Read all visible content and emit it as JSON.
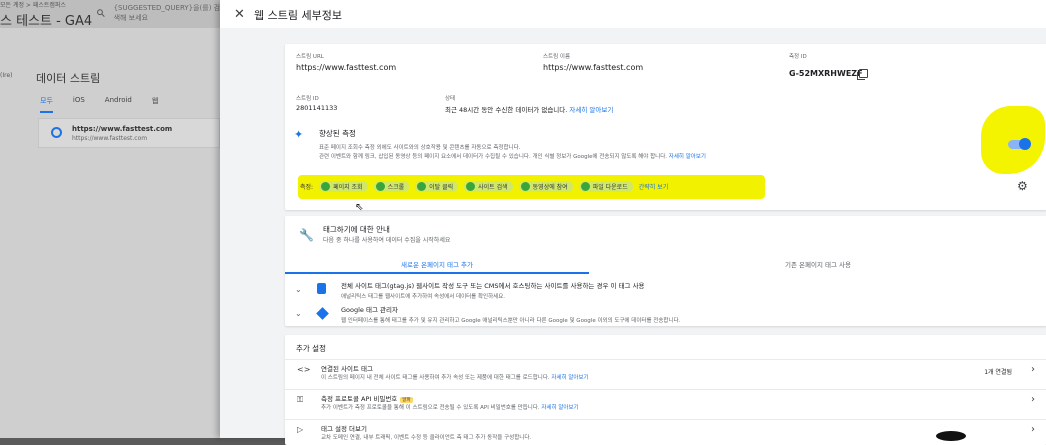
{
  "background": {
    "breadcrumb": "모든 계정 > 패스트캠퍼스",
    "property_title": "스 테스트 - GA4",
    "search_placeholder": "{SUGGESTED_QUERY}을(를) 검색해 보세요",
    "left_label": "(Ire)",
    "data_stream_heading": "데이터 스트림",
    "tabs": [
      "모두",
      "iOS",
      "Android",
      "웹"
    ],
    "stream_card": {
      "url": "https://www.fasttest.com",
      "url_sub": "https://www.fasttest.com"
    }
  },
  "panel": {
    "title": "웹 스트림 세부정보",
    "details": {
      "url_label": "스트림 URL",
      "url_value": "https://www.fasttest.com",
      "name_label": "스트림 이름",
      "name_value": "https://www.fasttest.com",
      "measure_id_label": "측정 ID",
      "measure_id_value": "G-52MXRHWEZF",
      "stream_id_label": "스트림 ID",
      "stream_id_value": "2801141133",
      "status_label": "상태",
      "status_value": "최근 48시간 동안 수신한 데이터가 없습니다.",
      "status_link": "자세히 알아보기"
    },
    "enhanced": {
      "title": "향상된 측정",
      "desc1": "표준 페이지 조회수 측정 외에도 사이트와의 상호작용 및 콘텐츠를 자동으로 측정합니다.",
      "desc2": "관련 이벤트와 함께 링크, 삽입된 동영상 등의 페이지 요소에서 데이터가 수집될 수 있습니다. 개인 식별 정보가 Google에 전송되지 않도록 해야 합니다.",
      "desc_link": "자세히 알아보기",
      "toggle_on": true,
      "chips_label": "측정:",
      "chips": [
        "페이지 조회",
        "스크롤",
        "이탈 클릭",
        "사이트 검색",
        "동영상에 참여",
        "파일 다운로드"
      ],
      "more_link": "간략히 보기"
    },
    "tagging": {
      "title": "태그하기에 대한 안내",
      "subtitle": "다음 중 하나를 사용하여 데이터 수집을 시작하세요",
      "tab_new": "새로운 온페이지 태그 추가",
      "tab_existing": "기존 온페이지 태그 사용",
      "row1_title": "전체 사이트 태그(gtag.js) 웹사이트 작성 도구 또는 CMS에서 호스팅하는 사이트를 사용하는 경우 이 태그 사용",
      "row1_sub": "애널리틱스 태그를 웹사이트에 추가하여 속성에서 데이터를 확인하세요.",
      "row2_title": "Google 태그 관리자",
      "row2_sub": "웹 인터페이스를 통해 태그를 추가 및 유지 관리하고 Google 애널리틱스뿐만 아니라 다른 Google 및 Google 이외의 도구에 데이터를 전송합니다."
    },
    "additional": {
      "title": "추가 설정",
      "rows": [
        {
          "title": "연결된 사이트 태그",
          "sub": "이 스트림의 페이지 내 전체 사이트 태그를 사용하여 추가 속성 또는 제품에 대한 태그를 로드합니다.",
          "link": "자세히 알아보기",
          "right": "1개 연결됨"
        },
        {
          "title": "측정 프로토콜 API 비밀번호",
          "badge": "알파",
          "sub": "추가 이벤트가 측정 프로토콜을 통해 이 스트림으로 전송될 수 있도록 API 비밀번호를 만듭니다.",
          "link": "자세히 알아보기"
        },
        {
          "title": "태그 설정 더보기",
          "sub": "교차 도메인 연결, 내부 트래픽, 이벤트 수정 등 클라이언트 측 태그 추가 동작을 구성합니다."
        }
      ]
    }
  }
}
